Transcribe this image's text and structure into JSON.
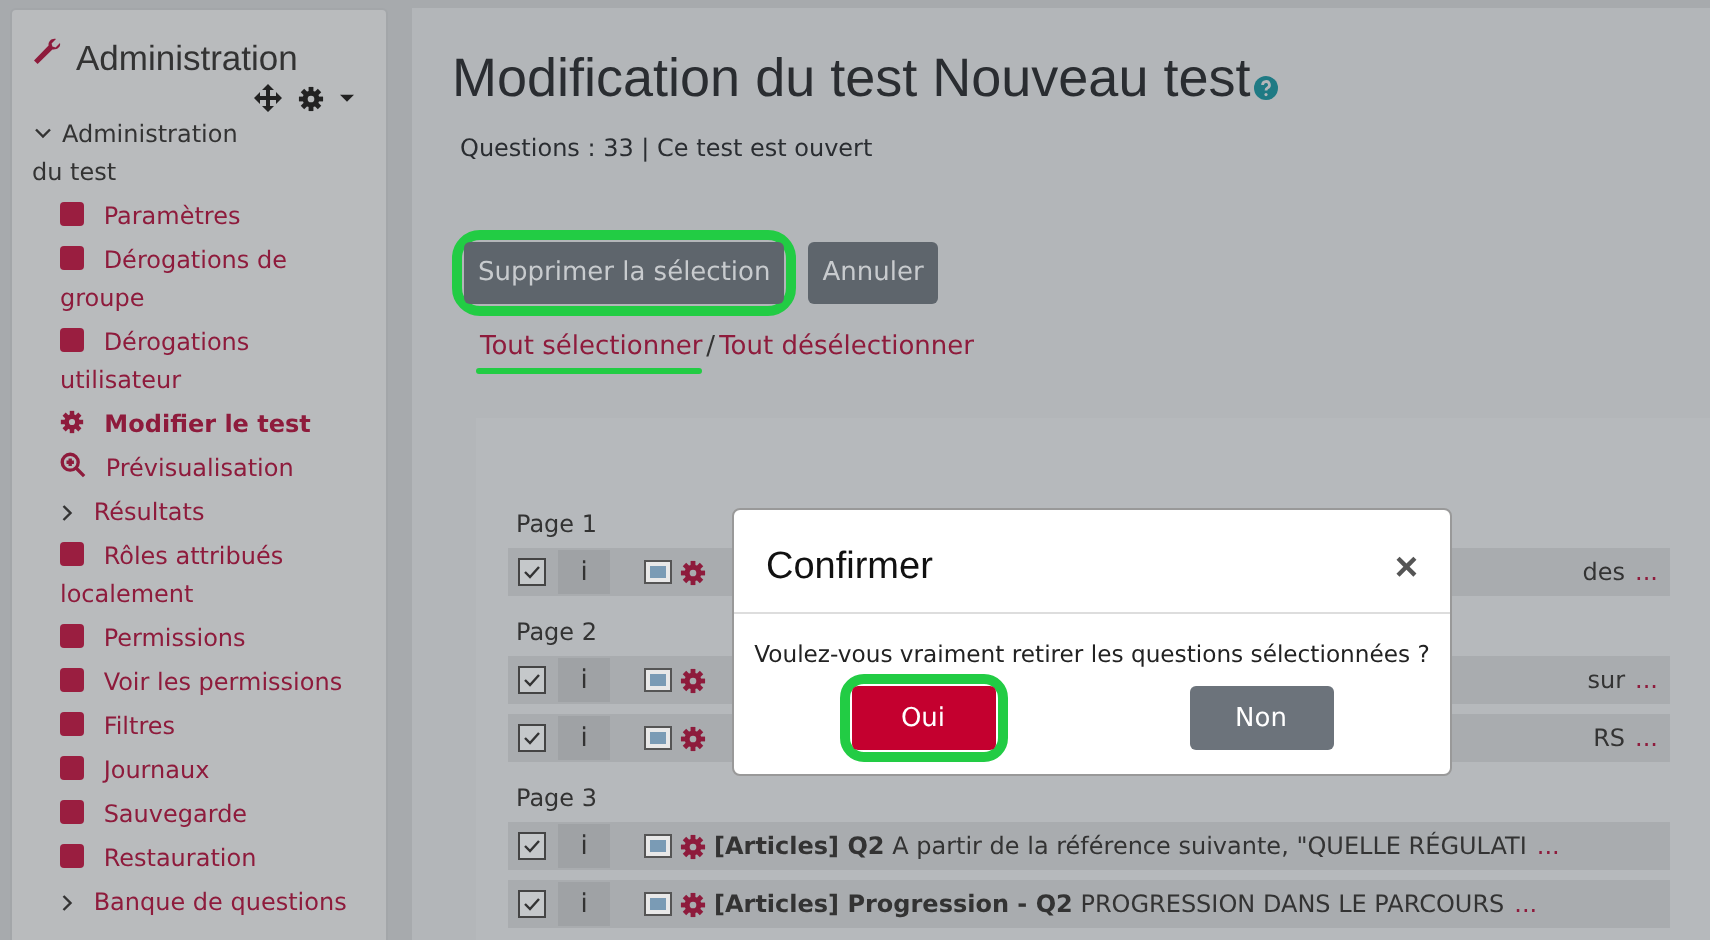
{
  "sidebar": {
    "title": "Administration",
    "section": {
      "label": "Administration du test",
      "expanded": true
    },
    "items": [
      {
        "label": "Paramètres",
        "kind": "square",
        "selected": false
      },
      {
        "label": "Dérogations de groupe",
        "kind": "square",
        "selected": false
      },
      {
        "label": "Dérogations utilisateur",
        "kind": "square",
        "selected": false
      },
      {
        "label": "Modifier le test",
        "kind": "gear",
        "selected": true
      },
      {
        "label": "Prévisualisation",
        "kind": "zoom",
        "selected": false
      },
      {
        "label": "Résultats",
        "kind": "chevron",
        "selected": false
      },
      {
        "label": "Rôles attribués localement",
        "kind": "square",
        "selected": false
      },
      {
        "label": "Permissions",
        "kind": "square",
        "selected": false
      },
      {
        "label": "Voir les permissions",
        "kind": "square",
        "selected": false
      },
      {
        "label": "Filtres",
        "kind": "square",
        "selected": false
      },
      {
        "label": "Journaux",
        "kind": "square",
        "selected": false
      },
      {
        "label": "Sauvegarde",
        "kind": "square",
        "selected": false
      },
      {
        "label": "Restauration",
        "kind": "square",
        "selected": false
      },
      {
        "label": "Banque de questions",
        "kind": "chevron",
        "selected": false
      }
    ]
  },
  "page": {
    "title": "Modification du test Nouveau test",
    "info": "Questions : 33 | Ce test est ouvert"
  },
  "buttons": [
    {
      "label": "Supprimer la sélection",
      "highlighted": true
    },
    {
      "label": "Annuler",
      "highlighted": false
    }
  ],
  "links": [
    {
      "label": "Tout sélectionner",
      "highlighted": true
    },
    {
      "label": "Tout désélectionner",
      "highlighted": false
    }
  ],
  "link_separator": "/",
  "pages": [
    {
      "label": "Page 1",
      "rows": [
        {
          "checked": true,
          "info": "i",
          "tail": "des",
          "more": "..."
        }
      ]
    },
    {
      "label": "Page 2",
      "rows": [
        {
          "checked": true,
          "info": "i",
          "tail": "sur",
          "more": "..."
        },
        {
          "checked": true,
          "info": "i",
          "tail": "RS",
          "more": "..."
        }
      ]
    },
    {
      "label": "Page 3",
      "rows": [
        {
          "checked": true,
          "info": "i",
          "bold": "[Articles] Q2",
          "text": "A partir de la référence suivante, \"QUELLE RÉGULATI",
          "more": "..."
        },
        {
          "checked": true,
          "info": "i",
          "bold": "[Articles] Progression - Q2",
          "text": "PROGRESSION DANS LE PARCOURS",
          "more": "..."
        }
      ]
    }
  ],
  "dialog": {
    "title": "Confirmer",
    "close": "×",
    "message": "Voulez-vous vraiment retirer les questions sélectionnées ?",
    "buttons": [
      {
        "label": "Oui",
        "kind": "primary",
        "highlighted": true
      },
      {
        "label": "Non",
        "kind": "secondary",
        "highlighted": false
      }
    ]
  }
}
